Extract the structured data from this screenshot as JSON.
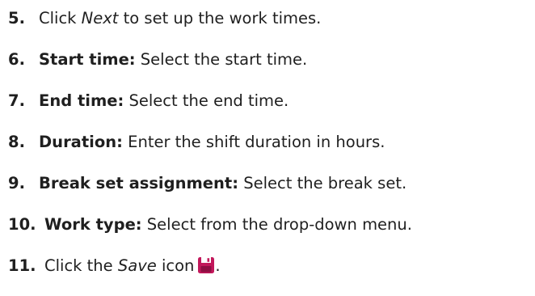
{
  "steps": [
    {
      "number": "5.",
      "text_before": "Click ",
      "emphasis": "Next",
      "text_after": " to set up the work times."
    },
    {
      "number": "6.",
      "term": "Start time:",
      "text": " Select the start time."
    },
    {
      "number": "7.",
      "term": "End time:",
      "text": " Select the end time."
    },
    {
      "number": "8.",
      "term": "Duration:",
      "text": " Enter the shift duration in hours."
    },
    {
      "number": "9.",
      "term": "Break set assignment:",
      "text": " Select the break set."
    },
    {
      "number": "10.",
      "term": "Work type:",
      "text": " Select from the drop-down menu."
    },
    {
      "number": "11.",
      "text_before": "Click the ",
      "emphasis": "Save",
      "text_after": " icon",
      "text_end": ".",
      "icon": "save-icon",
      "icon_color": "#c2185b"
    }
  ],
  "colors": {
    "text": "#1f1f1f",
    "save_icon": "#c2185b"
  }
}
